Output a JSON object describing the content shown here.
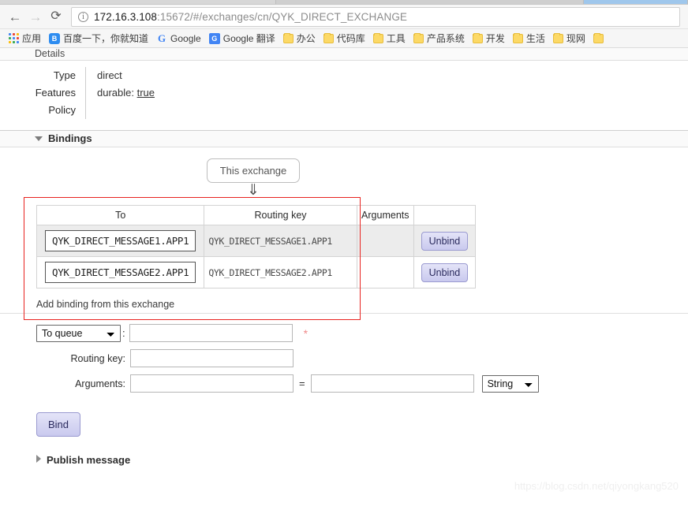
{
  "browser": {
    "back_icon": "back-arrow-icon",
    "forward_icon": "forward-arrow-icon",
    "reload_icon": "reload-icon",
    "back_glyph": "←",
    "forward_glyph": "→",
    "reload_glyph": "⟳",
    "info_glyph": "ⓘ",
    "url_host": "172.16.3.108",
    "url_rest": ":15672/#/exchanges/cn/QYK_DIRECT_EXCHANGE",
    "url_full": "172.16.3.108:15672/#/exchanges/cn/QYK_DIRECT_EXCHANGE"
  },
  "bookmarks": [
    {
      "icon": "apps-grid-icon",
      "label": "应用"
    },
    {
      "icon": "baidu-icon",
      "label": "百度一下，你就知道",
      "glyph": "熊"
    },
    {
      "icon": "google-icon",
      "label": "Google",
      "glyph": "G"
    },
    {
      "icon": "google-translate-icon",
      "label": "Google 翻译",
      "glyph": "文"
    },
    {
      "icon": "folder-icon",
      "label": "办公"
    },
    {
      "icon": "folder-icon",
      "label": "代码库"
    },
    {
      "icon": "folder-icon",
      "label": "工具"
    },
    {
      "icon": "folder-icon",
      "label": "产品系统"
    },
    {
      "icon": "folder-icon",
      "label": "开发"
    },
    {
      "icon": "folder-icon",
      "label": "生活"
    },
    {
      "icon": "folder-icon",
      "label": "现网"
    },
    {
      "icon": "folder-icon",
      "label": ""
    }
  ],
  "details": {
    "section_title": "Details",
    "rows": [
      {
        "key": "Type",
        "value": "direct",
        "underlined": ""
      },
      {
        "key": "Features",
        "value": "durable: ",
        "underlined": "true"
      },
      {
        "key": "Policy",
        "value": "",
        "underlined": ""
      }
    ]
  },
  "bindings": {
    "section_title": "Bindings",
    "node_label": "This exchange",
    "arrow_glyph": "⇓",
    "columns": [
      "To",
      "Routing key",
      "Arguments",
      ""
    ],
    "rows": [
      {
        "to": "QYK_DIRECT_MESSAGE1.APP1",
        "routing_key": "QYK_DIRECT_MESSAGE1.APP1",
        "arguments": "",
        "action": "Unbind"
      },
      {
        "to": "QYK_DIRECT_MESSAGE2.APP1",
        "routing_key": "QYK_DIRECT_MESSAGE2.APP1",
        "arguments": "",
        "action": "Unbind"
      }
    ],
    "highlight_color": "#e8231f"
  },
  "add_binding": {
    "title": "Add binding from this exchange",
    "destination_select": "To queue",
    "destination_value": "",
    "destination_placeholder": "",
    "required_marker": "*",
    "colon": ":",
    "routing_key_label": "Routing key:",
    "routing_key_value": "",
    "arguments_label": "Arguments:",
    "arguments_key_value": "",
    "equals": "=",
    "arguments_val_value": "",
    "type_select": "String",
    "submit_label": "Bind"
  },
  "publish": {
    "title": "Publish message"
  },
  "watermark": "https://blog.csdn.net/qiyongkang520"
}
